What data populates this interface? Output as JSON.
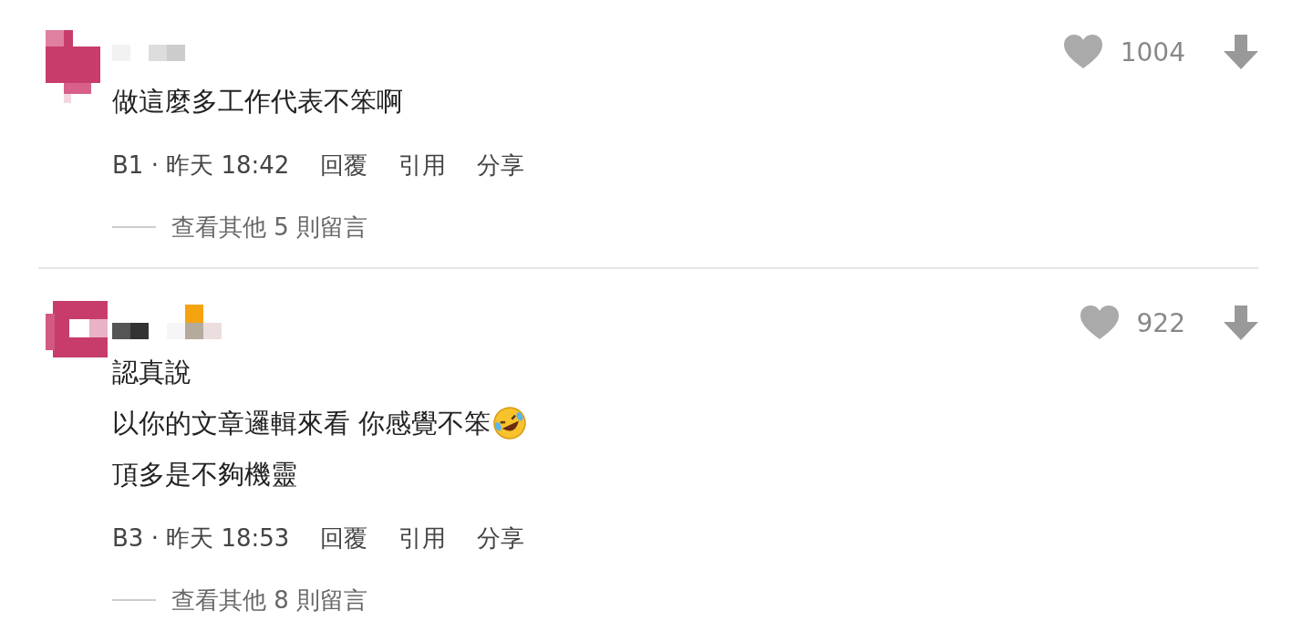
{
  "comments": [
    {
      "kind": "square",
      "lines": [
        {
          "kind": "plain",
          "text": "做這麼多工作代表不笨啊"
        }
      ],
      "meta": "B1 · 昨天 18:42",
      "actions": [
        "回覆",
        "引用",
        "分享"
      ],
      "likes": "1004",
      "more": "查看其他 5 則留言"
    },
    {
      "kind": "ring",
      "lines": [
        {
          "kind": "plain",
          "text": "認真說"
        },
        {
          "kind": "emoji",
          "text": "以你的文章邏輯來看 你感覺不笨"
        },
        {
          "kind": "plain",
          "text": "頂多是不夠機靈"
        }
      ],
      "meta": "B3 · 昨天 18:53",
      "actions": [
        "回覆",
        "引用",
        "分享"
      ],
      "likes": "922",
      "more": "查看其他 8 則留言"
    }
  ]
}
